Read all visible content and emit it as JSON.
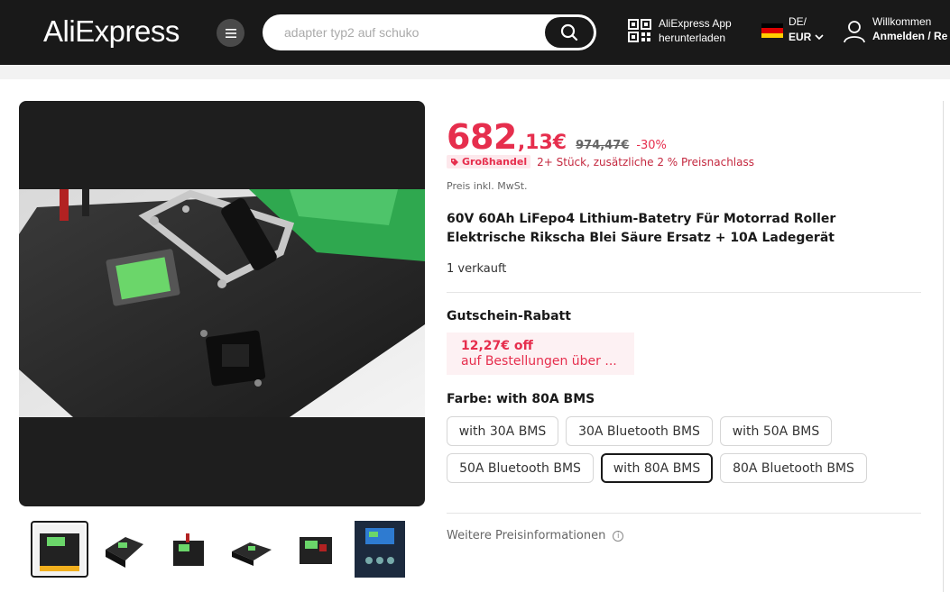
{
  "header": {
    "logo": "AliExpress",
    "search_placeholder": "adapter typ2 auf schuko",
    "app_line1": "AliExpress App",
    "app_line2": "herunterladen",
    "lang_line1": "DE/",
    "lang_line2": "EUR",
    "user_line1": "Willkommen",
    "user_line2": "Anmelden / Re"
  },
  "product": {
    "price_main": "682",
    "price_dec": ",13€",
    "price_old": "974,47€",
    "discount": "-30%",
    "wholesale_badge": "Großhandel",
    "wholesale_text": "2+ Stück, zusätzliche 2 % Preisnachlass",
    "tax": "Preis inkl. MwSt.",
    "title": "60V 60Ah LiFepo4 Lithium-Batetry Für Motorrad Roller Elektrische Rikscha Blei Säure Ersatz + 10A Ladegerät",
    "sold": "1 verkauft",
    "coupon_heading": "Gutschein-Rabatt",
    "coupon_amount": "12,27€ off",
    "coupon_desc": "auf Bestellungen über ...",
    "color_label": "Farbe: with 80A BMS",
    "options": [
      "with 30A BMS",
      "30A Bluetooth BMS",
      "with 50A BMS",
      "50A Bluetooth BMS",
      "with 80A BMS",
      "80A Bluetooth BMS"
    ],
    "selected_option": "with 80A BMS",
    "more_info": "Weitere Preisinformationen"
  },
  "colors": {
    "accent": "#e62e4d",
    "header_bg": "#191919"
  }
}
